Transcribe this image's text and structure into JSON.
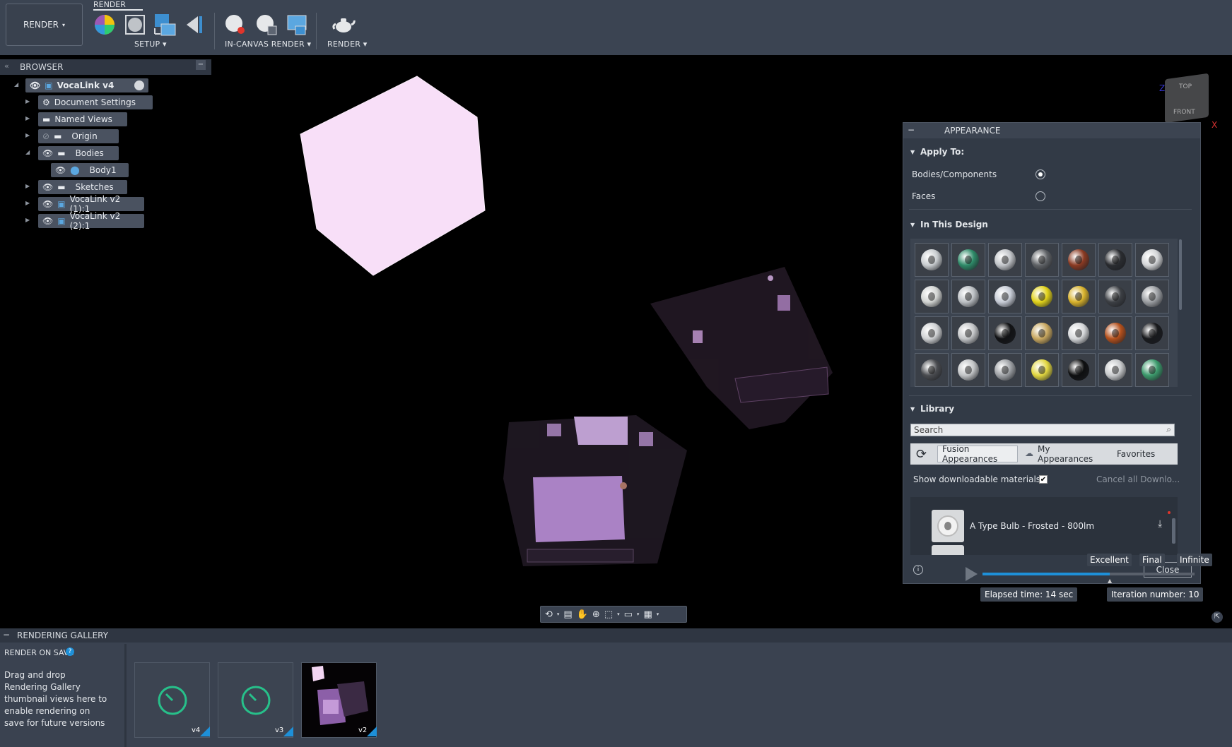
{
  "toolbar": {
    "active_tab": "RENDER",
    "workspace_button": "RENDER",
    "groups": [
      {
        "label": "SETUP"
      },
      {
        "label": "IN-CANVAS RENDER"
      },
      {
        "label": "RENDER"
      }
    ]
  },
  "browser": {
    "title": "BROWSER",
    "items": [
      {
        "label": "VocaLink v4"
      },
      {
        "label": "Document Settings"
      },
      {
        "label": "Named Views"
      },
      {
        "label": "Origin"
      },
      {
        "label": "Bodies"
      },
      {
        "label": "Body1"
      },
      {
        "label": "Sketches"
      },
      {
        "label": "VocaLink v2 (1):1"
      },
      {
        "label": "VocaLink v2 (2):1"
      }
    ]
  },
  "viewcube": {
    "top": "TOP",
    "front": "FRONT",
    "axis_x": "X",
    "axis_z": "Z"
  },
  "appearance": {
    "title": "APPEARANCE",
    "apply_to": {
      "heading": "Apply To:",
      "options": [
        {
          "label": "Bodies/Components",
          "selected": true
        },
        {
          "label": "Faces",
          "selected": false
        }
      ]
    },
    "in_this_design": {
      "heading": "In This Design",
      "swatches": [
        "#c9cdd0",
        "#2e8a68",
        "#c1c4c8",
        "#5f6266",
        "#8a3a22",
        "#2a2c30",
        "#d4d6d8",
        "#d2d4d2",
        "#bcc0c4",
        "#c7ccd6",
        "#e1d21a",
        "#d8b22c",
        "#3c3f44",
        "#9c9fa3",
        "#d0d2d4",
        "#c4c6c8",
        "#111214",
        "#c9a860",
        "#d6d8da",
        "#b4501c",
        "#18191c",
        "#4a4c50",
        "#c2c4c6",
        "#9fa2a6",
        "#e1d640",
        "#0e0f10",
        "#c8cacc",
        "#3c9a6c"
      ]
    },
    "library": {
      "heading": "Library",
      "search_placeholder": "Search",
      "tabs": [
        "Fusion Appearances",
        "My Appearances",
        "Favorites"
      ],
      "show_downloadable": "Show downloadable materials",
      "show_downloadable_checked": true,
      "cancel_downloads": "Cancel all Downlo...",
      "items": [
        {
          "label": "A Type Bulb - Frosted - 800lm"
        }
      ]
    },
    "close_label": "Close"
  },
  "render_quality": {
    "levels": [
      "Excellent",
      "Final",
      "Infinite"
    ],
    "elapsed": "Elapsed time: 14 sec",
    "iteration": "Iteration number: 10"
  },
  "gallery": {
    "title": "RENDERING GALLERY",
    "render_on_save": "RENDER ON SAVE",
    "help": "?",
    "description": "Drag and drop Rendering Gallery thumbnail views here to enable rendering on save for future versions",
    "thumbnails": [
      {
        "label": "v4",
        "state": "rendering"
      },
      {
        "label": "v3",
        "state": "rendering"
      },
      {
        "label": "v2",
        "state": "done"
      }
    ]
  },
  "colors": {
    "accent_blue": "#1e90d8",
    "toolbar_bg": "#3b4452",
    "render_pink": "#f6dcf6"
  }
}
